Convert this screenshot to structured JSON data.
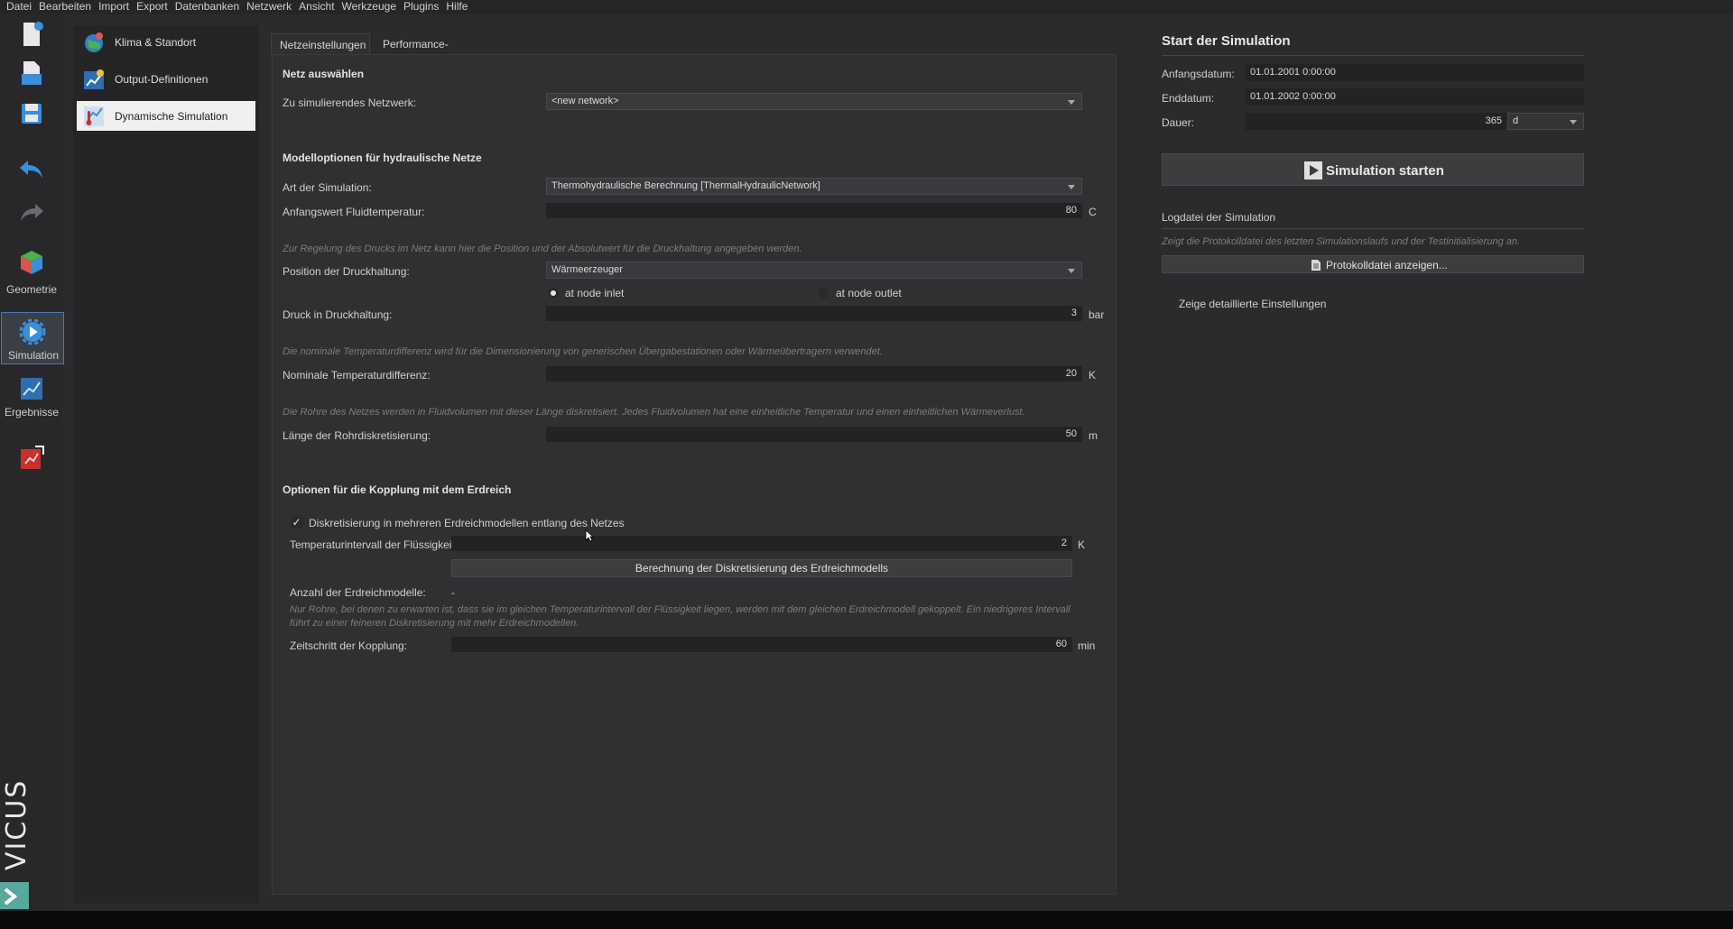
{
  "menu": [
    "Datei",
    "Bearbeiten",
    "Import",
    "Export",
    "Datenbanken",
    "Netzwerk",
    "Ansicht",
    "Werkzeuge",
    "Plugins",
    "Hilfe"
  ],
  "toolbar": {
    "geometry_label": "Geometrie",
    "simulation_label": "Simulation",
    "results_label": "Ergebnisse"
  },
  "brand": "VICUS",
  "nav": {
    "items": [
      {
        "label": "Klima & Standort"
      },
      {
        "label": "Output-Definitionen"
      },
      {
        "label": "Dynamische Simulation"
      }
    ]
  },
  "tabs": [
    {
      "label": "Netzeinstellungen"
    },
    {
      "label": "Performance-Optionen"
    }
  ],
  "network": {
    "section_select": "Netz auswählen",
    "network_label": "Zu simulierendes Netzwerk:",
    "network_value": "<new network>",
    "section_hydraulic": "Modelloptionen für hydraulische Netze",
    "sim_type_label": "Art der Simulation:",
    "sim_type_value": "Thermohydraulische Berechnung [ThermalHydraulicNetwork]",
    "init_temp_label": "Anfangswert Fluidtemperatur:",
    "init_temp_value": "80",
    "init_temp_unit": "C",
    "pressure_hint": "Zur Regelung des Drucks im Netz kann hier die Position und der Absolutwert für die Druckhaltung angegeben werden.",
    "pressure_pos_label": "Position der Druckhaltung:",
    "pressure_pos_value": "Wärmeerzeuger",
    "radio_inlet": "at node inlet",
    "radio_outlet": "at node outlet",
    "pressure_label": "Druck in Druckhaltung:",
    "pressure_value": "3",
    "pressure_unit": "bar",
    "temp_diff_hint": "Die nominale Temperaturdifferenz wird für die Dimensionierung von generischen Übergabestationen oder Wärmeübertragern verwendet.",
    "temp_diff_label": "Nominale Temperaturdifferenz:",
    "temp_diff_value": "20",
    "temp_diff_unit": "K",
    "pipe_hint": "Die Rohre des Netzes werden in Fluidvolumen mit dieser Länge diskretisiert. Jedes Fluidvolumen hat eine einheitliche Temperatur und einen einheitlichen Wärmeverlust.",
    "pipe_len_label": "Länge der Rohrdiskretisierung:",
    "pipe_len_value": "50",
    "pipe_len_unit": "m",
    "section_soil": "Optionen für die Kopplung mit dem Erdreich",
    "soil_checkbox_label": "Diskretisierung in mehreren Erdreichmodellen entlang des Netzes",
    "fluid_interval_label": "Temperaturintervall der Flüssigkeit:",
    "fluid_interval_value": "2",
    "fluid_interval_unit": "K",
    "calc_button": "Berechnung der Diskretisierung des Erdreichmodells",
    "soil_count_label": "Anzahl der Erdreichmodelle:",
    "soil_count_value": "-",
    "soil_hint_1": "Nur Rohre, bei denen zu erwarten ist, dass sie im gleichen Temperaturintervall der Flüssigkeit liegen, werden mit dem gleichen Erdreichmodell gekoppelt. Ein niedrigeres Intervall",
    "soil_hint_2": "führt zu einer feineren Diskretisierung mit mehr Erdreichmodellen.",
    "coupling_label": "Zeitschritt der Kopplung:",
    "coupling_value": "60",
    "coupling_unit": "min"
  },
  "simulation": {
    "title": "Start der Simulation",
    "start_label": "Anfangsdatum:",
    "start_value": "01.01.2001  0:00:00",
    "end_label": "Enddatum:",
    "end_value": "01.01.2002  0:00:00",
    "duration_label": "Dauer:",
    "duration_value": "365",
    "duration_unit": "d",
    "start_button": "Simulation starten",
    "log_title": "Logdatei der Simulation",
    "log_hint": "Zeigt die Protokolldatei des letzten Simulationslaufs und der Testinitialisierung an.",
    "log_button": "Protokolldatei anzeigen...",
    "detail_label": "Zeige detaillierte Einstellungen"
  },
  "colors": {
    "accent": "#4a79b8",
    "background": "#2b2b2d",
    "panel": "#303033",
    "field": "#232325"
  }
}
